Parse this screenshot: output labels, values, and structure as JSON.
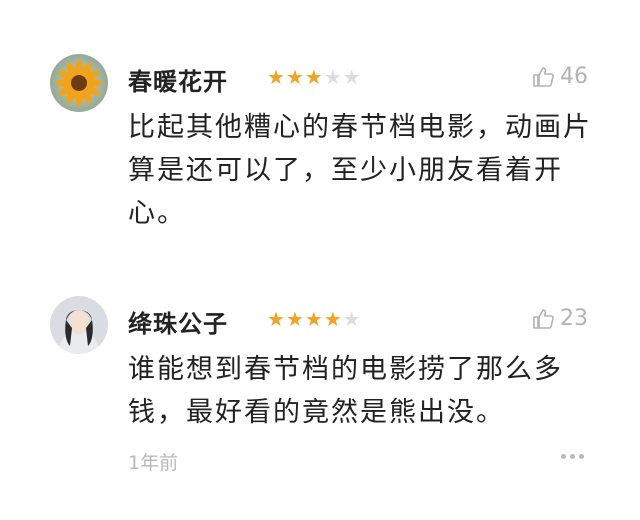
{
  "comments": [
    {
      "username": "春暖花开",
      "rating": 3,
      "rating_max": 5,
      "likes": "46",
      "text": "比起其他糟心的春节档电影，动画片算是还可以了，至少小朋友看着开心。",
      "avatar_icon": "sunflower-avatar"
    },
    {
      "username": "绛珠公子",
      "rating": 4,
      "rating_max": 5,
      "likes": "23",
      "text": "谁能想到春节档的电影捞了那么多钱，最好看的竟然是熊出没。",
      "timestamp": "1年前",
      "avatar_icon": "person-avatar"
    }
  ],
  "colors": {
    "star_active": "#f2a324",
    "star_inactive": "#dddddd",
    "meta_gray": "#b3b3b3"
  },
  "icons": {
    "like": "thumbs-up-icon",
    "more": "more-dots-icon"
  }
}
